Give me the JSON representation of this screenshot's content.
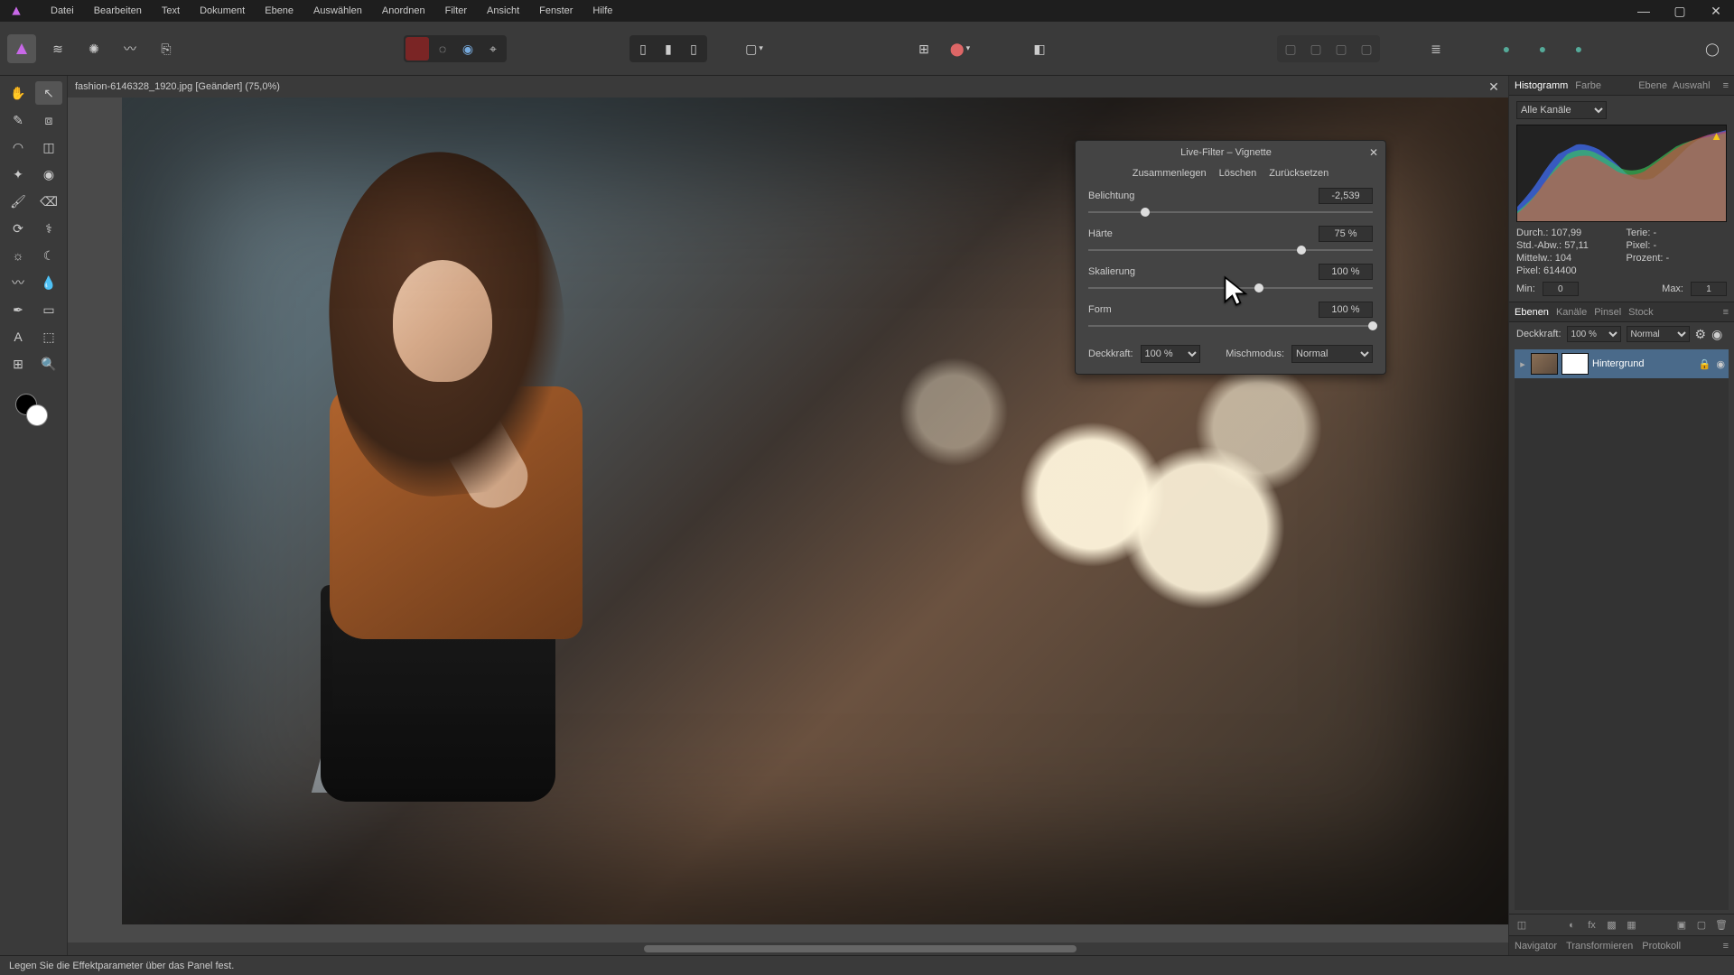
{
  "menu": [
    "Datei",
    "Bearbeiten",
    "Text",
    "Dokument",
    "Ebene",
    "Auswählen",
    "Anordnen",
    "Filter",
    "Ansicht",
    "Fenster",
    "Hilfe"
  ],
  "document": {
    "tab_label": "fashion-6146328_1920.jpg [Geändert] (75,0%)"
  },
  "live_filter": {
    "title": "Live-Filter – Vignette",
    "actions": {
      "merge": "Zusammenlegen",
      "delete": "Löschen",
      "reset": "Zurücksetzen"
    },
    "params": {
      "exposure": {
        "label": "Belichtung",
        "value": "-2,539",
        "pct": 20
      },
      "hardness": {
        "label": "Härte",
        "value": "75 %",
        "pct": 75
      },
      "scale": {
        "label": "Skalierung",
        "value": "100 %",
        "pct": 60
      },
      "shape": {
        "label": "Form",
        "value": "100 %",
        "pct": 100
      }
    },
    "opacity_label": "Deckkraft:",
    "opacity_value": "100 %",
    "blend_label": "Mischmodus:",
    "blend_value": "Normal"
  },
  "right": {
    "top_tabs": {
      "histogram": "Histogramm",
      "farbe": "Farbe"
    },
    "top_right": {
      "ebene": "Ebene",
      "auswahl": "Auswahl"
    },
    "channel_select": "Alle Kanäle",
    "stats": {
      "durch_l": "Durch.:",
      "durch_v": "107,99",
      "stdabw_l": "Std.-Abw.:",
      "stdabw_v": "57,11",
      "mittelw_l": "Mittelw.:",
      "mittelw_v": "104",
      "pixel_l": "Pixel:",
      "pixel_v": "614400",
      "terie_l": "Terie:",
      "terie_v": "-",
      "pixel2_l": "Pixel:",
      "pixel2_v": "-",
      "prozent_l": "Prozent:",
      "prozent_v": "-"
    },
    "min_label": "Min:",
    "min_value": "0",
    "max_label": "Max:",
    "max_value": "1",
    "mid_tabs": {
      "ebenen": "Ebenen",
      "kanale": "Kanäle",
      "pinsel": "Pinsel",
      "stock": "Stock"
    },
    "layer_opacity_label": "Deckkraft:",
    "layer_opacity_value": "100 %",
    "layer_blend": "Normal",
    "layer_name": "Hintergrund",
    "bottom_tabs": {
      "navigator": "Navigator",
      "transformieren": "Transformieren",
      "protokoll": "Protokoll"
    }
  },
  "status": {
    "hint": "Legen Sie die Effektparameter über das Panel fest."
  }
}
